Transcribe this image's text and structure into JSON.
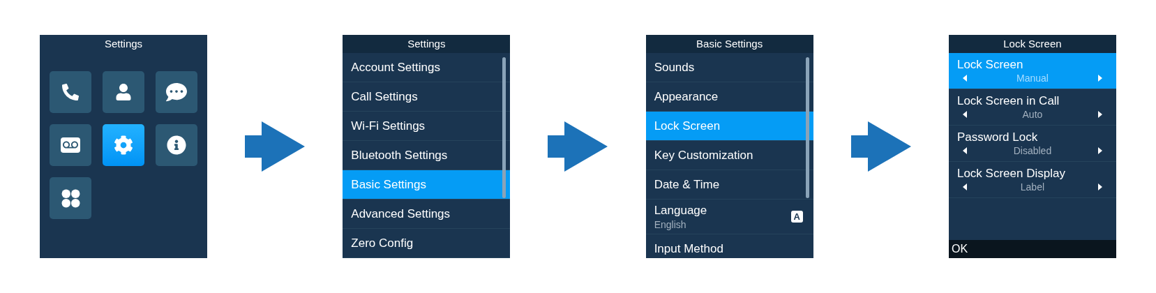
{
  "screens": [
    {
      "kind": "grid",
      "title": "Settings",
      "tiles": [
        {
          "kind": "calls",
          "selected": false
        },
        {
          "kind": "contacts",
          "selected": false
        },
        {
          "kind": "messages",
          "selected": false
        },
        {
          "kind": "voicemail",
          "selected": false
        },
        {
          "kind": "settings",
          "selected": true
        },
        {
          "kind": "info",
          "selected": false
        },
        {
          "kind": "apps",
          "selected": false
        }
      ]
    },
    {
      "kind": "list",
      "title": "Settings",
      "items": [
        {
          "label": "Account Settings",
          "selected": false
        },
        {
          "label": "Call Settings",
          "selected": false
        },
        {
          "label": "Wi-Fi Settings",
          "selected": false
        },
        {
          "label": "Bluetooth Settings",
          "selected": false
        },
        {
          "label": "Basic Settings",
          "selected": true
        },
        {
          "label": "Advanced Settings",
          "selected": false
        },
        {
          "label": "Zero Config",
          "selected": false
        }
      ]
    },
    {
      "kind": "list",
      "title": "Basic Settings",
      "items": [
        {
          "label": "Sounds",
          "selected": false
        },
        {
          "label": "Appearance",
          "selected": false
        },
        {
          "label": "Lock Screen",
          "selected": true
        },
        {
          "label": "Key Customization",
          "selected": false
        },
        {
          "label": "Date & Time",
          "selected": false
        },
        {
          "label": "Language",
          "sublabel": "English",
          "badge": "A",
          "selected": false
        },
        {
          "label": "Input Method",
          "selected": false
        }
      ]
    },
    {
      "kind": "options",
      "title": "Lock Screen",
      "items": [
        {
          "label": "Lock Screen",
          "value": "Manual",
          "selected": true
        },
        {
          "label": "Lock Screen in Call",
          "value": "Auto",
          "selected": false
        },
        {
          "label": "Password Lock",
          "value": "Disabled",
          "selected": false
        },
        {
          "label": "Lock Screen Display",
          "value": "Label",
          "selected": false
        }
      ],
      "softkey": "OK"
    }
  ]
}
